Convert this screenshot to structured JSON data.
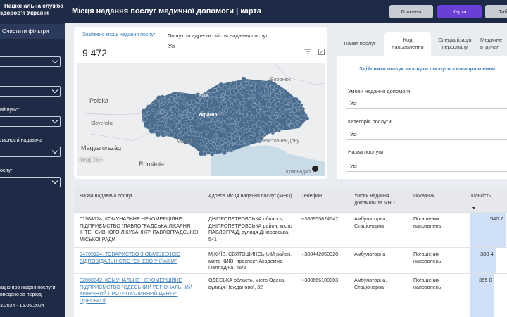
{
  "sidebar": {
    "brand_line1": "Національна служба",
    "brand_line2": "здоров'я України",
    "clear_filters": "Очистити фільтри",
    "filters": [
      {
        "label": "",
        "value": ""
      },
      {
        "label": "",
        "value": ""
      },
      {
        "label": "ий пункт",
        "value": ""
      },
      {
        "label": "ласності надавача",
        "value": ""
      },
      {
        "label": "ослуг",
        "value": ""
      }
    ],
    "footer_line1": "ацію про надані послуги",
    "footer_line2": "введено за період",
    "footer_period": "3.2024 - 15.06.2024"
  },
  "header": {
    "title": "Місця надання послуг медичної допомоги | карта",
    "buttons": {
      "home": "Головна",
      "map": "Карта",
      "table": "Табл"
    }
  },
  "map_card": {
    "found_label": "Знайдено місць надання послуг",
    "found_value": "9 472",
    "search_label": "Пошук за адресою місця надання послуг",
    "search_value": "Усі",
    "labels": {
      "poland": "Polska",
      "slovensko": "Slovensko",
      "magyarorszag": "Magyarország",
      "romania": "România",
      "moldova": "Moldova",
      "ukraine": "Україна",
      "kyiv": "Київ",
      "voronezh": "Воронеж",
      "rostov": "Ростов-на-Дону",
      "krasnodar": "Краснодар",
      "mapbox": "mapbox",
      "info": "i"
    },
    "marker_color": "#4a6d8f"
  },
  "right_panel": {
    "tabs": [
      {
        "label_line1": "Пакет послуг",
        "label_line2": ""
      },
      {
        "label_line1": "Код",
        "label_line2": "направлення"
      },
      {
        "label_line1": "Спеціалізація",
        "label_line2": "персоналу"
      },
      {
        "label_line1": "Медичне",
        "label_line2": "втручан"
      }
    ],
    "search_link": "Здійснити пошук за кодом послуги з е-направлення",
    "filters": [
      {
        "label": "Умови надання допомоги",
        "value": "Усі"
      },
      {
        "label": "Категорія послуги",
        "value": "Усі"
      },
      {
        "label": "Назва послуги",
        "value": "Усі"
      }
    ]
  },
  "table": {
    "columns": [
      "Назва надавача послуг",
      "Адреса місця надання послуг (МНП)",
      "Телефон",
      "Умови надання допомоги за МНП",
      "Показник",
      "Кількість"
    ],
    "rows": [
      {
        "name": "01984174, КОМУНАЛЬНЕ НЕКОМЕРЦІЙНЕ ПІДПРИЄМСТВО \"ПАВЛОГРАДСЬКА ЛІКАРНЯ ІНТЕНСИВНОГО ЛІКУВАННЯ\" ПАВЛОГРАДСЬКОЇ МІСЬКОЇ РАДИ",
        "address": "ДНІПРОПЕТРОВСЬКА область, ДНІПРОПЕТРОВСЬКА район, місто ПАВЛОГРАД, вулиця Дніпровська, 541",
        "phone": "+380955824647",
        "conditions": "Амбулаторна, Стаціонарна",
        "indicator": "Погашених направлень",
        "count": "540 7",
        "share": 0.97
      },
      {
        "name": "34709124, ТОВАРИСТВО З ОБМЕЖЕНОЮ ВІДПОВІДАЛЬНІСТЮ \"СІНЕВО УКРАЇНА\"",
        "address": "М.КИЇВ, СВЯТОШИНСЬКИЙ район, місто КИЇВ, проспект Академіка Палладіна, 46/2",
        "phone": "+380442050020",
        "conditions": "Амбулаторна",
        "indicator": "Погашених направлень",
        "count": "380 4",
        "share": 0.7
      },
      {
        "name": "02008342, КОМУНАЛЬНЕ НЕКОМЕРЦІЙНЕ ПІДПРИЄМСТВО \"ОДЕСЬКИЙ РЕГІОНАЛЬНИЙ КЛІНІЧНИЙ ПРОТИПУХЛИННИЙ ЦЕНТР\" ОДЕСЬКОЇ",
        "address": "ОДЕСЬКА область, місто Одеса, вулиця Нежданової, 32",
        "phone": "+380666100003",
        "conditions": "Амбулаторна, Стаціонарна",
        "indicator": "Погашених направлень",
        "count": "355 0",
        "share": 0.66
      }
    ]
  }
}
